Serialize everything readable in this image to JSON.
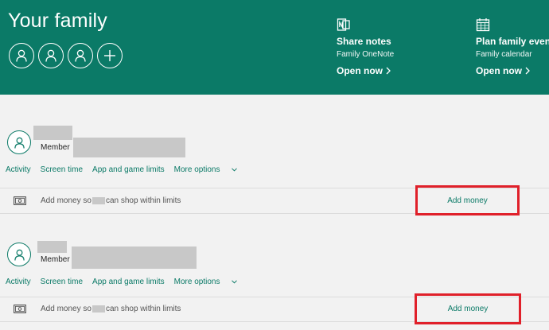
{
  "header": {
    "title": "Your family",
    "avatars": [
      "person-icon",
      "person-icon",
      "person-icon"
    ],
    "add_icon": "plus-icon",
    "quick_links": [
      {
        "icon": "onenote-icon",
        "title": "Share notes",
        "subtitle": "Family OneNote",
        "link": "Open now"
      },
      {
        "icon": "calendar-icon",
        "title": "Plan family events",
        "subtitle": "Family calendar",
        "link": "Open now"
      }
    ]
  },
  "members": [
    {
      "role": "Member",
      "tabs": [
        "Activity",
        "Screen time",
        "App and game limits",
        "More options"
      ],
      "money_prefix": "Add money so",
      "money_suffix": "can shop within limits",
      "add_money": "Add money"
    },
    {
      "role": "Member",
      "tabs": [
        "Activity",
        "Screen time",
        "App and game limits",
        "More options"
      ],
      "money_prefix": "Add money so",
      "money_suffix": "can shop within limits",
      "add_money": "Add money"
    }
  ],
  "colors": {
    "header": "#0b7a67",
    "accent": "#0b7a67",
    "highlight": "#e0202a",
    "background": "#f2f2f2"
  }
}
